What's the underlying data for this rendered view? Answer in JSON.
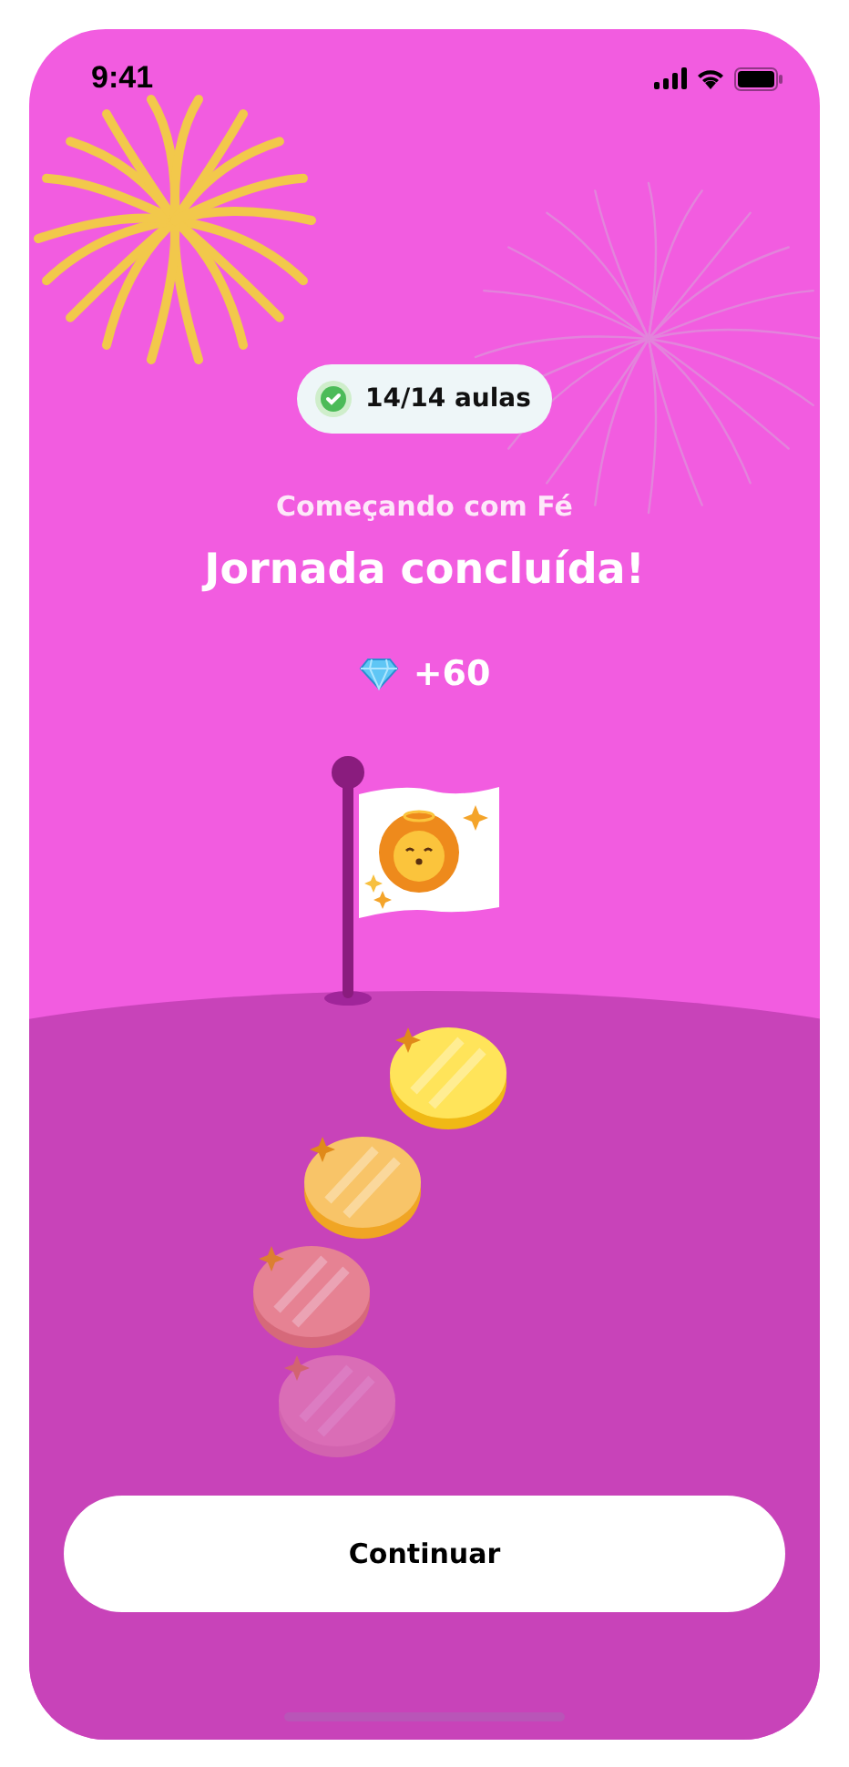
{
  "status_bar": {
    "time": "9:41"
  },
  "progress_badge": {
    "label": "14/14 aulas"
  },
  "subtitle": "Começando com Fé",
  "title": "Jornada concluída!",
  "reward": {
    "amount": "+60"
  },
  "button": {
    "label": "Continuar"
  }
}
